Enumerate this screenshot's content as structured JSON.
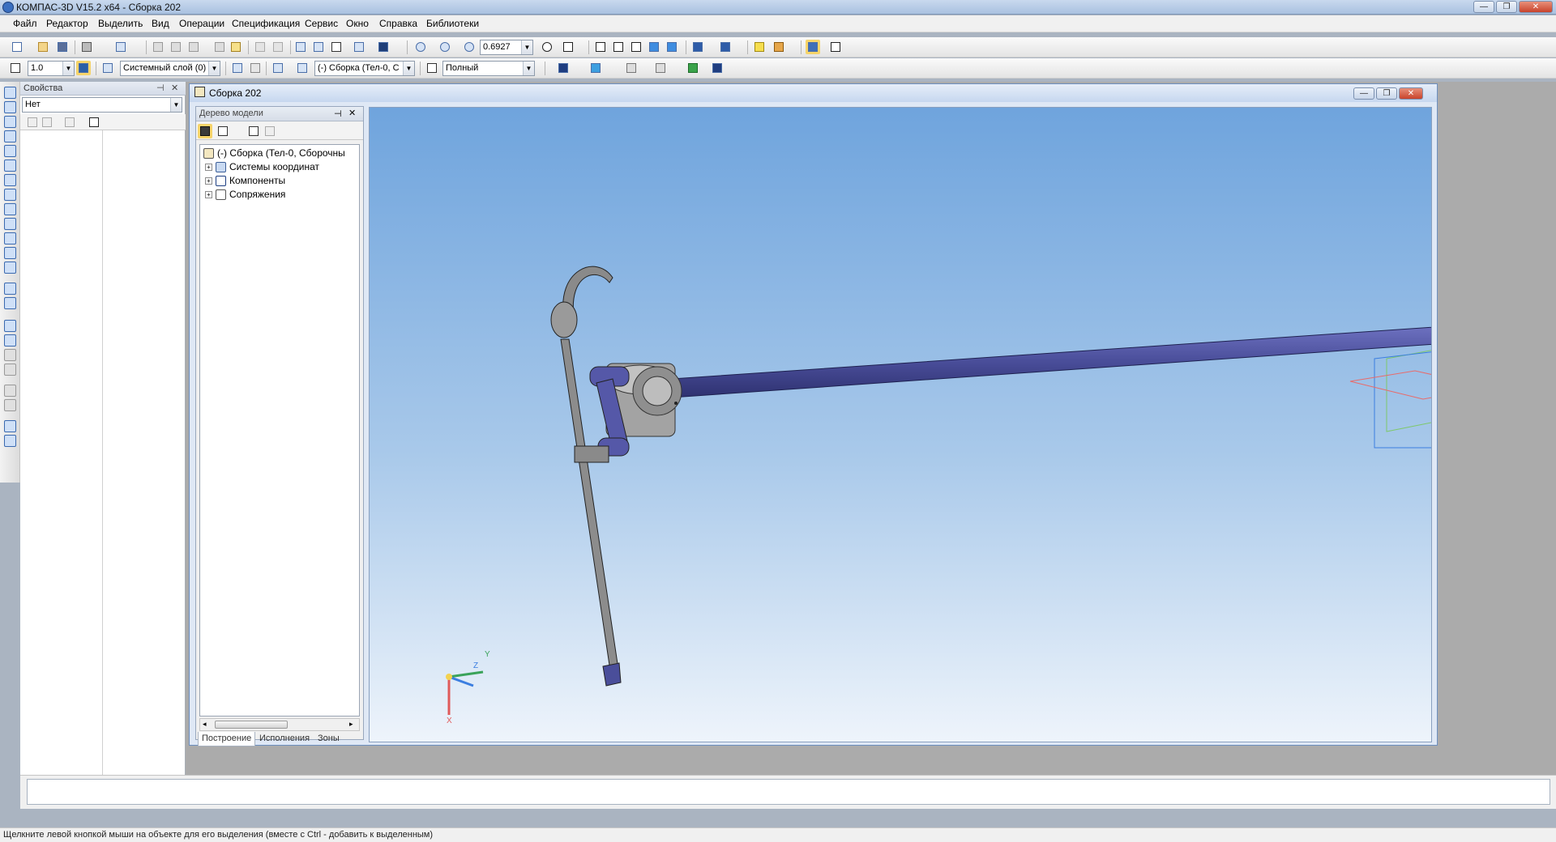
{
  "window": {
    "title": "КОМПАС-3D V15.2  x64 - Сборка 202"
  },
  "menu": [
    "Файл",
    "Редактор",
    "Выделить",
    "Вид",
    "Операции",
    "Спецификация",
    "Сервис",
    "Окно",
    "Справка",
    "Библиотеки"
  ],
  "toolbar1": {
    "zoom_value": "0.6927"
  },
  "toolbar2": {
    "step_value": "1.0",
    "layer": "Системный слой (0)",
    "assembly_combo": "(-) Сборка (Тел-0, С",
    "display_mode": "Полный"
  },
  "properties": {
    "title": "Свойства",
    "object_combo": "Нет"
  },
  "document": {
    "title": "Сборка 202"
  },
  "model_tree": {
    "title": "Дерево модели",
    "root": "(-) Сборка (Тел-0, Сборочны",
    "items": [
      "Системы координат",
      "Компоненты",
      "Сопряжения"
    ],
    "tabs": [
      "Построение",
      "Исполнения",
      "Зоны"
    ]
  },
  "axes_labels": {
    "x": "X",
    "y": "Y",
    "z": "Z"
  },
  "status": {
    "hint": "Щелкните левой кнопкой мыши на объекте для его выделения (вместе с Ctrl - добавить к выделенным)"
  },
  "colors": {
    "viewport_top": "#6fa4dd",
    "viewport_bottom": "#eef4fb",
    "shaft": "#4a4e9a",
    "wheel": "#9a9a9a"
  }
}
